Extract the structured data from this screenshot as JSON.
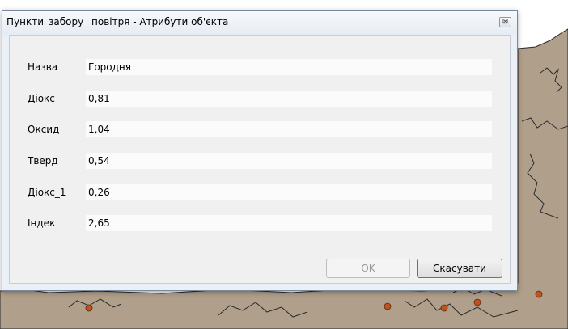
{
  "dialog": {
    "title": "Пункти_забору _повітря - Атрибути об'єкта",
    "close_glyph": "⊠"
  },
  "attributes": [
    {
      "label": "Назва",
      "value": "Городня"
    },
    {
      "label": "Діокс",
      "value": "0,81"
    },
    {
      "label": "Оксид",
      "value": "1,04"
    },
    {
      "label": "Тверд",
      "value": "0,54"
    },
    {
      "label": "Діокс_1",
      "value": "0,26"
    },
    {
      "label": "Індек",
      "value": "2,65"
    }
  ],
  "buttons": {
    "ok_label": "OK",
    "cancel_label": "Скасувати"
  },
  "colors": {
    "map_land": "#b09f8a",
    "map_border": "#2b2b2b",
    "point_marker": "#c0521f"
  }
}
